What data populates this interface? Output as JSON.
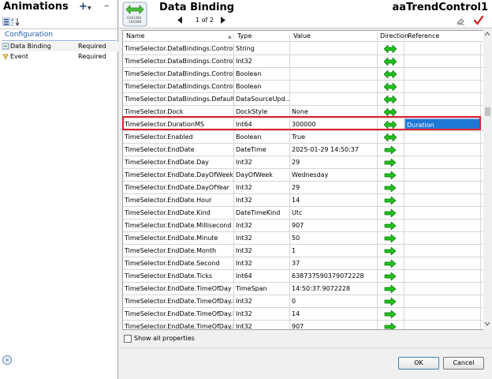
{
  "left_panel": {
    "title": "Animations",
    "add_label": "+",
    "remove_label": "–",
    "section_label": "Configuration",
    "animations": [
      {
        "name": "Data Binding",
        "status": "Required"
      },
      {
        "name": "Event",
        "status": "Required"
      }
    ]
  },
  "header": {
    "title": "Data Binding",
    "page": "1 of 2",
    "object_name": "aaTrendControl1"
  },
  "grid": {
    "columns": [
      "Name",
      "Type",
      "Value",
      "Direction",
      "Reference"
    ],
    "rows": [
      {
        "name": "TimeSelector.DataBindings.Control.T...",
        "type": "String",
        "value": "",
        "direction": "both",
        "reference": ""
      },
      {
        "name": "TimeSelector.DataBindings.Control.T...",
        "type": "Int32",
        "value": "",
        "direction": "both",
        "reference": ""
      },
      {
        "name": "TimeSelector.DataBindings.Control.U...",
        "type": "Boolean",
        "value": "",
        "direction": "both",
        "reference": ""
      },
      {
        "name": "TimeSelector.DataBindings.Control.V...",
        "type": "Boolean",
        "value": "",
        "direction": "both",
        "reference": ""
      },
      {
        "name": "TimeSelector.DataBindings.DefaultD...",
        "type": "DataSourceUpd...",
        "value": "",
        "direction": "both",
        "reference": ""
      },
      {
        "name": "TimeSelector.Dock",
        "type": "DockStyle",
        "value": "None",
        "direction": "both",
        "reference": ""
      },
      {
        "name": "TimeSelector.DurationMS",
        "type": "Int64",
        "value": "300000",
        "direction": "both",
        "reference": "Duration",
        "selected": true
      },
      {
        "name": "TimeSelector.Enabled",
        "type": "Boolean",
        "value": "True",
        "direction": "both",
        "reference": ""
      },
      {
        "name": "TimeSelector.EndDate",
        "type": "DateTime",
        "value": "2025-01-29 14:50:37",
        "direction": "right",
        "reference": ""
      },
      {
        "name": "TimeSelector.EndDate.Day",
        "type": "Int32",
        "value": "29",
        "direction": "right",
        "reference": ""
      },
      {
        "name": "TimeSelector.EndDate.DayOfWeek",
        "type": "DayOfWeek",
        "value": "Wednesday",
        "direction": "right",
        "reference": ""
      },
      {
        "name": "TimeSelector.EndDate.DayOfYear",
        "type": "Int32",
        "value": "29",
        "direction": "right",
        "reference": ""
      },
      {
        "name": "TimeSelector.EndDate.Hour",
        "type": "Int32",
        "value": "14",
        "direction": "right",
        "reference": ""
      },
      {
        "name": "TimeSelector.EndDate.Kind",
        "type": "DateTimeKind",
        "value": "Utc",
        "direction": "right",
        "reference": ""
      },
      {
        "name": "TimeSelector.EndDate.Millisecond",
        "type": "Int32",
        "value": "907",
        "direction": "right",
        "reference": ""
      },
      {
        "name": "TimeSelector.EndDate.Minute",
        "type": "Int32",
        "value": "50",
        "direction": "right",
        "reference": ""
      },
      {
        "name": "TimeSelector.EndDate.Month",
        "type": "Int32",
        "value": "1",
        "direction": "right",
        "reference": ""
      },
      {
        "name": "TimeSelector.EndDate.Second",
        "type": "Int32",
        "value": "37",
        "direction": "right",
        "reference": ""
      },
      {
        "name": "TimeSelector.EndDate.Ticks",
        "type": "Int64",
        "value": "638737590379072228",
        "direction": "right",
        "reference": ""
      },
      {
        "name": "TimeSelector.EndDate.TimeOfDay",
        "type": "TimeSpan",
        "value": "14:50:37.9072228",
        "direction": "right",
        "reference": ""
      },
      {
        "name": "TimeSelector.EndDate.TimeOfDay.D...",
        "type": "Int32",
        "value": "0",
        "direction": "right",
        "reference": ""
      },
      {
        "name": "TimeSelector.EndDate.TimeOfDay.H...",
        "type": "Int32",
        "value": "14",
        "direction": "right",
        "reference": ""
      },
      {
        "name": "TimeSelector.EndDate.TimeOfDay.Mi...",
        "type": "Int32",
        "value": "907",
        "direction": "right",
        "reference": ""
      }
    ]
  },
  "show_all_label": "Show all properties",
  "buttons": {
    "ok": "OK",
    "cancel": "Cancel"
  },
  "colors": {
    "accent": "#1e78d6",
    "selection_outline": "#e02030",
    "arrow_green": "#21c21d"
  }
}
